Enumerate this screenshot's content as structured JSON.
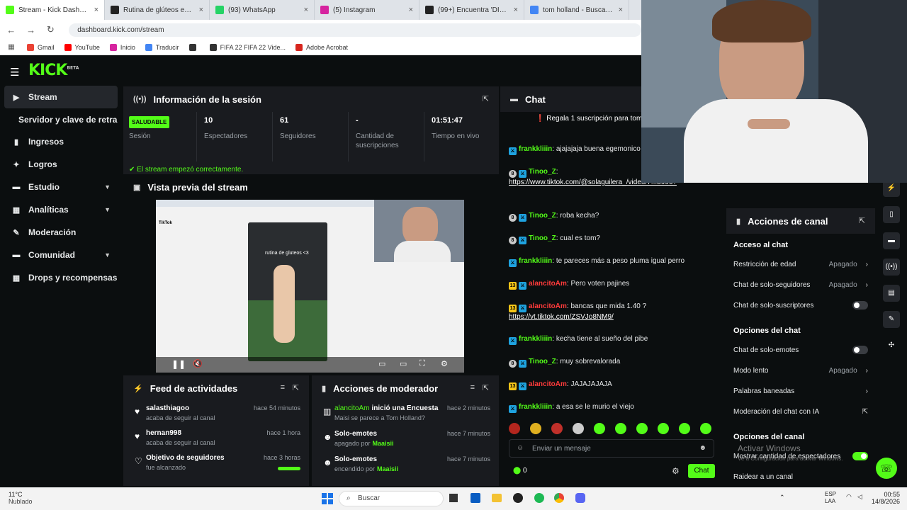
{
  "browser": {
    "tabs": [
      {
        "title": "Stream - Kick Dashboard",
        "color": "#53fc18",
        "active": true
      },
      {
        "title": "Rutina de glúteos en cas",
        "color": "#222",
        "active": false
      },
      {
        "title": "(93) WhatsApp",
        "color": "#25d366",
        "active": false
      },
      {
        "title": "(5) Instagram",
        "color": "#d6249f",
        "active": false
      },
      {
        "title": "(99+) Encuentra 'DISFRACES",
        "color": "#222",
        "active": false
      },
      {
        "title": "tom holland - Buscar con G",
        "color": "#4285f4",
        "active": false
      }
    ],
    "url": "dashboard.kick.com/stream",
    "bookmarks": [
      {
        "label": "Gmail",
        "color": "#ea4335"
      },
      {
        "label": "YouTube",
        "color": "#ff0000"
      },
      {
        "label": "Inicio",
        "color": "#d6249f"
      },
      {
        "label": "Traducir",
        "color": "#4285f4"
      },
      {
        "label": "",
        "color": "#333"
      },
      {
        "label": "FIFA 22 FIFA 22 Vide...",
        "color": "#333"
      },
      {
        "label": "Adobe Acrobat",
        "color": "#d7261e"
      }
    ]
  },
  "app": {
    "logo": "KICK",
    "logo_sup": "BETA",
    "accent": "#53fc18",
    "sidebar": [
      {
        "label": "Stream",
        "icon": "stream-icon",
        "glyph": "▶",
        "active": true
      },
      {
        "label": "Servidor y clave de retransmisión",
        "icon": "",
        "glyph": ""
      },
      {
        "label": "Ingresos",
        "icon": "income-icon",
        "glyph": "▮"
      },
      {
        "label": "Logros",
        "icon": "trophy-icon",
        "glyph": "✦"
      },
      {
        "label": "Estudio",
        "icon": "studio-icon",
        "glyph": "▬",
        "chevron": true
      },
      {
        "label": "Analíticas",
        "icon": "analytics-icon",
        "glyph": "▦",
        "chevron": true
      },
      {
        "label": "Moderación",
        "icon": "wrench-icon",
        "glyph": "✎"
      },
      {
        "label": "Comunidad",
        "icon": "community-icon",
        "glyph": "▬",
        "chevron": true
      },
      {
        "label": "Drops y recompensas",
        "icon": "drops-icon",
        "glyph": "▦"
      }
    ],
    "session": {
      "title": "Información de la sesión",
      "status_badge": "SALUDABLE",
      "status_label": "Sesión",
      "viewers_value": "10",
      "viewers_label": "Espectadores",
      "followers_value": "61",
      "followers_label": "Seguidores",
      "subs_value": "-",
      "subs_label": "Cantidad de suscripciones",
      "live_value": "01:51:47",
      "live_label": "Tiempo en vivo",
      "notice": "El stream empezó correctamente."
    },
    "preview": {
      "title": "Vista previa del stream",
      "video_caption": "rutina de gluteos <3"
    },
    "feed": {
      "title": "Feed de actividades",
      "items": [
        {
          "name": "salasthiagoo",
          "desc": "acaba de seguir al canal",
          "time": "hace 54 minutos",
          "icon": "heart-icon"
        },
        {
          "name": "hernan998",
          "desc": "acaba de seguir al canal",
          "time": "hace 1 hora",
          "icon": "heart-icon"
        },
        {
          "name": "Objetivo de seguidores",
          "desc": "fue alcanzado",
          "time": "hace 3 horas",
          "icon": "heart-outline-icon",
          "progress": 1.0
        }
      ]
    },
    "modactions": {
      "title": "Acciones de moderador",
      "items": [
        {
          "name": "alancitoAm",
          "action": "inició una Encuesta",
          "desc": "Maisi se parece a Tom Holland?",
          "time": "hace 2 minutos",
          "icon": "poll-icon"
        },
        {
          "name": "Solo-emotes",
          "desc_pre": "apagado por",
          "desc_user": "Maaisii",
          "time": "hace 7 minutos",
          "icon": "smile-icon"
        },
        {
          "name": "Solo-emotes",
          "desc_pre": "encendido por",
          "desc_user": "Maaisii",
          "time": "hace 7 minutos",
          "icon": "smile-icon"
        }
      ]
    },
    "chat": {
      "title": "Chat",
      "pinned": "Regala 1 suscripción para tom",
      "messages": [
        {
          "user": "frankkliiin",
          "color": "#53fc18",
          "badges": [
            "mod"
          ],
          "text": "ajajajaja buena egemonico"
        },
        {
          "user": "Tinoo_Z",
          "color": "#53fc18",
          "badges": [
            "8",
            "mod"
          ],
          "text": "",
          "link": "https://www.tiktok.com/@solaguilera_/video/7...8996?"
        },
        {
          "user": "Tinoo_Z",
          "color": "#53fc18",
          "badges": [
            "8",
            "mod"
          ],
          "text": "roba kecha?"
        },
        {
          "user": "Tinoo_Z",
          "color": "#53fc18",
          "badges": [
            "8",
            "mod"
          ],
          "text": "cual es tom?"
        },
        {
          "user": "frankkliiin",
          "color": "#53fc18",
          "badges": [
            "mod"
          ],
          "text": "te pareces más a peso pluma igual perro"
        },
        {
          "user": "alancitoAm",
          "color": "#ff3b3b",
          "badges": [
            "13",
            "mod"
          ],
          "text": "Pero voten pajines"
        },
        {
          "user": "alancitoAm",
          "color": "#ff3b3b",
          "badges": [
            "13",
            "mod"
          ],
          "text": "bancas que mida 1.40 ?",
          "link": "https://vt.tiktok.com/ZSVJo8NM9/"
        },
        {
          "user": "frankkliiin",
          "color": "#53fc18",
          "badges": [
            "mod"
          ],
          "text": "kecha tiene al sueño del pibe"
        },
        {
          "user": "Tinoo_Z",
          "color": "#53fc18",
          "badges": [
            "8",
            "mod"
          ],
          "text": "muy sobrevalorada"
        },
        {
          "user": "alancitoAm",
          "color": "#ff3b3b",
          "badges": [
            "13",
            "mod"
          ],
          "text": "JAJAJAJAJA"
        },
        {
          "user": "frankkliiin",
          "color": "#53fc18",
          "badges": [
            "mod"
          ],
          "text": "a esa se le murio el viejo"
        }
      ],
      "input_placeholder": "Enviar un mensaje",
      "count": "0",
      "send_label": "Chat"
    },
    "channel_actions": {
      "title": "Acciones de canal",
      "sections": [
        {
          "heading": "Acceso al chat",
          "rows": [
            {
              "label": "Restricción de edad",
              "value": "Apagado",
              "type": "nav"
            },
            {
              "label": "Chat de solo-seguidores",
              "value": "Apagado",
              "type": "nav"
            },
            {
              "label": "Chat de solo-suscriptores",
              "type": "toggle",
              "on": false
            }
          ]
        },
        {
          "heading": "Opciones del chat",
          "rows": [
            {
              "label": "Chat de solo-emotes",
              "type": "toggle",
              "on": false
            },
            {
              "label": "Modo lento",
              "value": "Apagado",
              "type": "nav"
            },
            {
              "label": "Palabras baneadas",
              "type": "nav"
            },
            {
              "label": "Moderación del chat con IA",
              "type": "external"
            }
          ]
        },
        {
          "heading": "Opciones del canal",
          "rows": [
            {
              "label": "Mostrar cantidad de espectadores",
              "type": "toggle",
              "on": true
            },
            {
              "label": "Raidear a un canal",
              "type": "plain"
            }
          ]
        }
      ]
    },
    "watermark": {
      "title": "Activar Windows",
      "sub": "Ve a Configuración para activar Windows."
    }
  },
  "taskbar": {
    "weather_temp": "11°C",
    "weather_desc": "Nublado",
    "search_placeholder": "Buscar",
    "lang": "ESP",
    "lang2": "LAA",
    "time": "00:55",
    "date": "14/8/2026"
  }
}
